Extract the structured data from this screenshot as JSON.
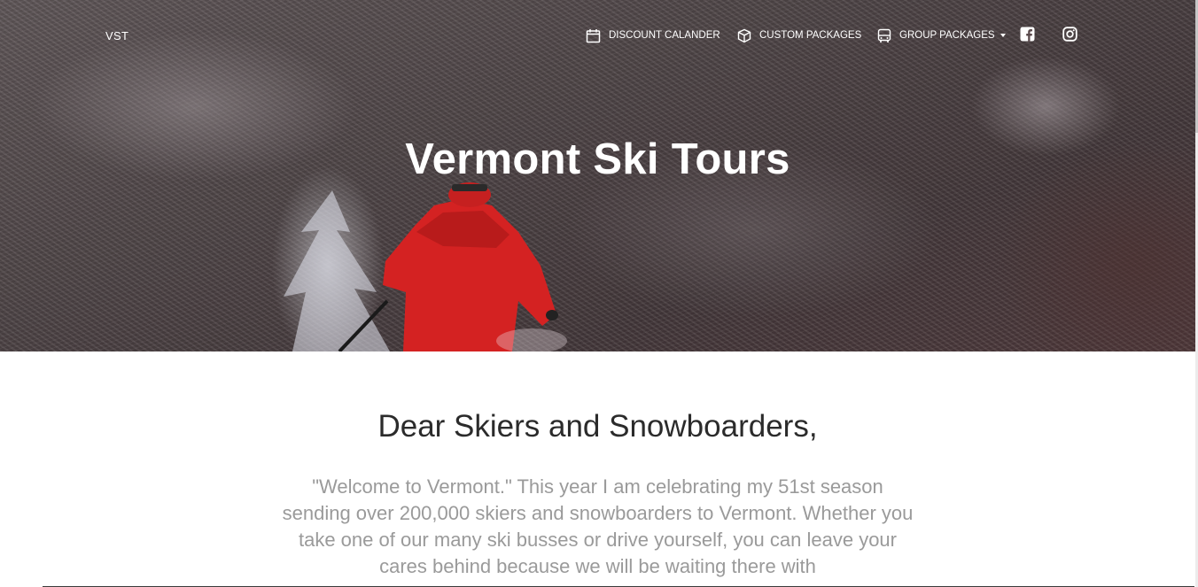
{
  "nav": {
    "brand": "VST",
    "items": [
      {
        "label": "DISCOUNT CALANDER",
        "icon": "calendar-icon"
      },
      {
        "label": "CUSTOM PACKAGES",
        "icon": "box-icon"
      },
      {
        "label": "GROUP PACKAGES",
        "icon": "bus-icon",
        "dropdown": true
      }
    ],
    "social": [
      "facebook-icon",
      "instagram-icon"
    ]
  },
  "hero": {
    "title": "Vermont Ski Tours"
  },
  "main": {
    "greeting": "Dear Skiers and Snowboarders,",
    "letter": "\"Welcome to Vermont.\" This year I am celebrating my 51st season sending over 200,000 skiers and snowboarders to Vermont. Whether you take one of our many ski busses or drive yourself, you can leave your cares behind because we will be waiting there with"
  },
  "colors": {
    "nav_text": "#ffffff",
    "greeting_text": "#2b2b2b",
    "letter_text": "#9a9a9a",
    "jacket": "#d42222"
  }
}
